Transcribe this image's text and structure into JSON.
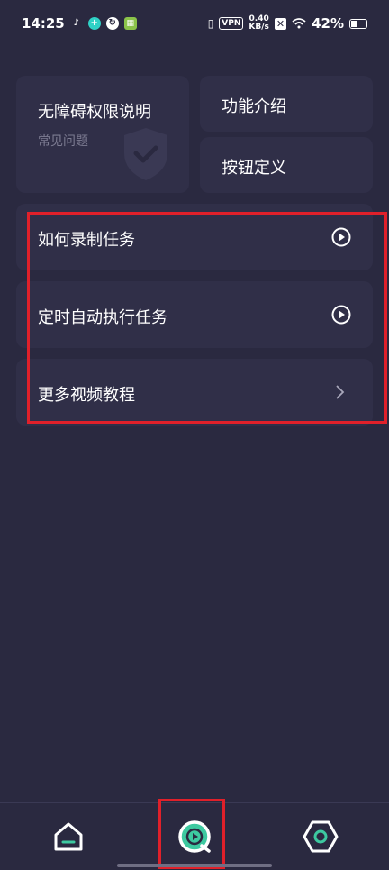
{
  "status_bar": {
    "time": "14:25",
    "vpn": "VPN",
    "net_speed_value": "0.40",
    "net_speed_unit": "KB/s",
    "battery": "42%",
    "battery_level": 0.42
  },
  "cards": {
    "accessibility": {
      "title": "无障碍权限说明",
      "subtitle": "常见问题"
    },
    "feature_intro": {
      "title": "功能介绍"
    },
    "button_def": {
      "title": "按钮定义"
    }
  },
  "tutorials": [
    {
      "label": "如何录制任务"
    },
    {
      "label": "定时自动执行任务"
    },
    {
      "label": "更多视频教程"
    }
  ],
  "colors": {
    "background": "#2a2940",
    "card": "#302f48",
    "accent": "#3dc9a0",
    "highlight": "#e0202a"
  },
  "nav": {
    "home_icon": "home-icon",
    "tutorial_icon": "play-circle-icon",
    "settings_icon": "hexagon-settings-icon"
  }
}
